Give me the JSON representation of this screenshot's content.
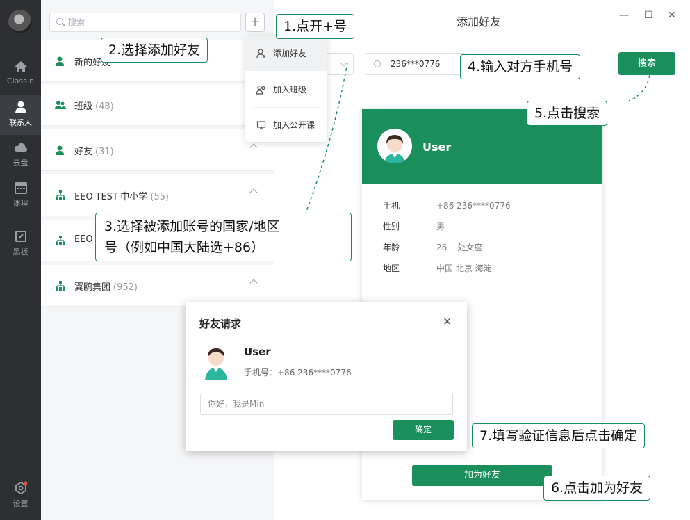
{
  "rail": {
    "items": [
      {
        "label": "ClassIn",
        "icon": "home-icon"
      },
      {
        "label": "联系人",
        "icon": "contacts-icon"
      },
      {
        "label": "云盘",
        "icon": "cloud-icon"
      },
      {
        "label": "课程",
        "icon": "calendar-icon"
      },
      {
        "label": "黑板",
        "icon": "blackboard-icon"
      },
      {
        "label": "设置",
        "icon": "settings-icon"
      }
    ]
  },
  "contacts": {
    "search_placeholder": "搜索",
    "plus": "+",
    "groups": [
      {
        "name": "新的好友",
        "count": ""
      },
      {
        "name": "班级",
        "count": "(48)"
      },
      {
        "name": "好友",
        "count": "(31)"
      },
      {
        "name": "EEO-TEST-中小学",
        "count": "(55)"
      },
      {
        "name": "EEO",
        "count": ""
      },
      {
        "name": "翼鸥集团",
        "count": "(952)"
      }
    ]
  },
  "menu": {
    "items": [
      "添加好友",
      "加入班级",
      "加入公开课"
    ]
  },
  "main": {
    "title": "添加好友",
    "controls": {
      "minimize": "—",
      "maximize": "☐",
      "close": "✕"
    },
    "phone_value": "236***0776",
    "search_btn": "搜索"
  },
  "card": {
    "username": "User",
    "rows": [
      {
        "key": "手机",
        "value": "+86 236****0776"
      },
      {
        "key": "性别",
        "value": "男"
      },
      {
        "key": "年龄",
        "value": "26    处女座"
      },
      {
        "key": "地区",
        "value": "中国 北京 海淀"
      }
    ],
    "add_btn": "加为好友"
  },
  "dialog": {
    "title": "好友请求",
    "close": "✕",
    "username": "User",
    "phone": "手机号：+86 236****0776",
    "message": "你好，我是Min",
    "ok": "确定"
  },
  "callouts": {
    "c1": "1.点开+号",
    "c2": "2.选择添加好友",
    "c3_line1": "3.选择被添加账号的国家/地区",
    "c3_line2": "号（例如中国大陆选+86）",
    "c4": "4.输入对方手机号",
    "c5": "5.点击搜索",
    "c6": "6.点击加为好友",
    "c7": "7.填写验证信息后点击确定"
  },
  "colors": {
    "brand": "#1a8f5c",
    "rail": "#2d2f33"
  }
}
